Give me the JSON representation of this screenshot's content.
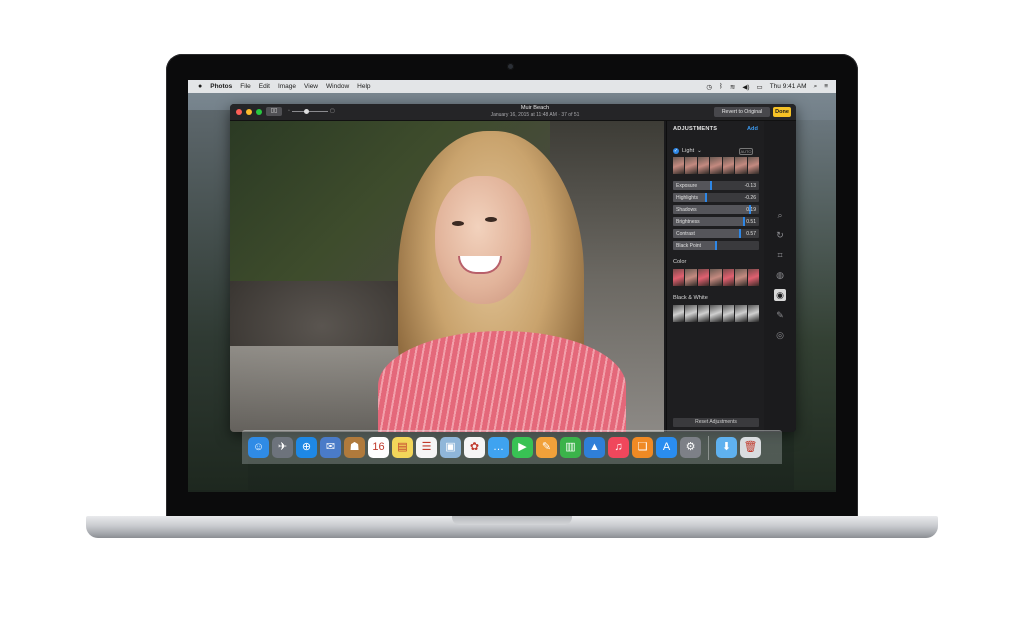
{
  "menubar": {
    "apple": "",
    "app": "Photos",
    "items": [
      "File",
      "Edit",
      "Image",
      "View",
      "Window",
      "Help"
    ],
    "clock": "Thu 9:41 AM"
  },
  "window": {
    "title": "Muir Beach",
    "subtitle": "January 16, 2015 at 11:48 AM  ·  37 of 51",
    "revert_label": "Revert to Original",
    "done_label": "Done"
  },
  "adjustments": {
    "title": "ADJUSTMENTS",
    "add_label": "Add",
    "light": {
      "label": "Light",
      "auto_label": "AUTO",
      "sliders": [
        {
          "label": "Exposure",
          "value": "-0.13",
          "level": 0.44
        },
        {
          "label": "Highlights",
          "value": "-0.26",
          "level": 0.38
        },
        {
          "label": "Shadows",
          "value": "0.19",
          "level": 0.9
        },
        {
          "label": "Brightness",
          "value": "0.51",
          "level": 0.82
        },
        {
          "label": "Contrast",
          "value": "0.57",
          "level": 0.78
        },
        {
          "label": "Black Point",
          "value": "",
          "level": 0.5
        }
      ]
    },
    "color_label": "Color",
    "bw_label": "Black & White",
    "reset_label": "Reset Adjustments",
    "accent": "#2e87e6"
  },
  "tools": [
    "magnify-icon",
    "rotate-icon",
    "crop-icon",
    "filters-icon",
    "adjust-icon",
    "retouch-icon",
    "red-eye-icon"
  ],
  "dock": {
    "apps": [
      {
        "name": "finder",
        "glyph": "☺",
        "color": "#2f8be6"
      },
      {
        "name": "launchpad",
        "glyph": "✈",
        "color": "#6d737c"
      },
      {
        "name": "safari",
        "glyph": "⊕",
        "color": "#1e88e5"
      },
      {
        "name": "mail-photo",
        "glyph": "✉",
        "color": "#4a7bc8"
      },
      {
        "name": "contacts",
        "glyph": "☗",
        "color": "#b07a3c"
      },
      {
        "name": "calendar",
        "glyph": "16",
        "color": "#ffffff"
      },
      {
        "name": "notes",
        "glyph": "▤",
        "color": "#f3d65a"
      },
      {
        "name": "reminders",
        "glyph": "☰",
        "color": "#f5f5f5"
      },
      {
        "name": "preview",
        "glyph": "▣",
        "color": "#8fb6d9"
      },
      {
        "name": "photos",
        "glyph": "✿",
        "color": "#f5f5f5"
      },
      {
        "name": "messages",
        "glyph": "…",
        "color": "#3fa3f0"
      },
      {
        "name": "facetime",
        "glyph": "▶",
        "color": "#38c254"
      },
      {
        "name": "pages",
        "glyph": "✎",
        "color": "#f1a13a"
      },
      {
        "name": "numbers",
        "glyph": "▥",
        "color": "#3bb34a"
      },
      {
        "name": "keynote",
        "glyph": "▲",
        "color": "#2f7fd8"
      },
      {
        "name": "music",
        "glyph": "♫",
        "color": "#f0475c"
      },
      {
        "name": "books",
        "glyph": "❑",
        "color": "#f08a24"
      },
      {
        "name": "app-store",
        "glyph": "A",
        "color": "#2a8df0"
      },
      {
        "name": "system-preferences",
        "glyph": "⚙",
        "color": "#7d8087"
      }
    ],
    "extras": [
      {
        "name": "downloads-folder",
        "glyph": "⬇",
        "color": "#5fb1ef"
      },
      {
        "name": "trash",
        "glyph": "🗑",
        "color": "#d9dcdf"
      }
    ]
  }
}
